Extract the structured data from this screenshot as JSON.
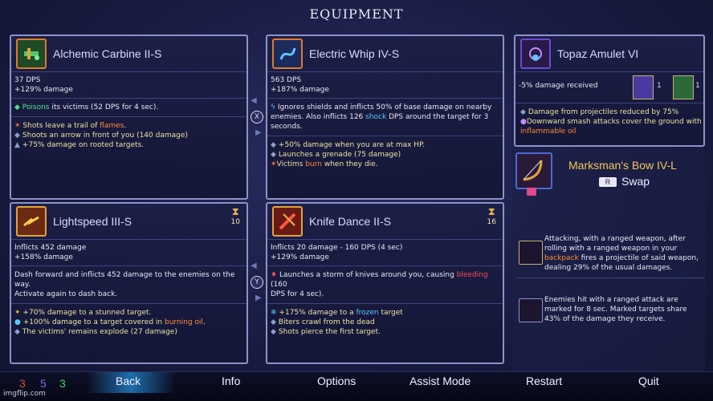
{
  "header": {
    "title": "EQUIPMENT"
  },
  "weapons": [
    {
      "name": "Alchemic Carbine II-S",
      "stats": [
        "37 DPS",
        "+129% damage"
      ],
      "desc": [
        {
          "pre": "",
          "hl": "Poisons",
          "post": " its victims (52 DPS for 4 sec)."
        }
      ],
      "mods": [
        {
          "pre": "Shots leave a trail of ",
          "hl": "flames",
          "post": "."
        },
        {
          "pre": "Shoots an arrow in front of you (140 damage)",
          "hl": "",
          "post": ""
        },
        {
          "pre": "+75% damage on rooted targets.",
          "hl": "",
          "post": ""
        }
      ]
    },
    {
      "name": "Electric Whip IV-S",
      "stats": [
        "563 DPS",
        "+187% damage"
      ],
      "desc_lines": [
        "Ignores shields and inflicts 50% of base damage on nearby",
        "enemies. Also inflicts 126 ",
        "shock",
        " DPS around the target for 3",
        "seconds."
      ],
      "mods": [
        {
          "pre": "+50% damage when you are at max HP.",
          "hl": "",
          "post": ""
        },
        {
          "pre": "Launches a grenade (75 damage)",
          "hl": "",
          "post": ""
        },
        {
          "pre": "Victims ",
          "hl": "burn",
          "post": " when they die."
        }
      ]
    },
    {
      "name": "Lightspeed III-S",
      "timer": "10",
      "stats": [
        "Inflicts 452 damage",
        "+158% damage"
      ],
      "desc_lines": [
        "Dash forward and inflicts 452 damage to the enemies on the way.",
        "Activate again to dash back."
      ],
      "mods": [
        {
          "pre": "+70% damage to a stunned target.",
          "hl": "",
          "post": ""
        },
        {
          "pre": "+100% damage to a target covered in ",
          "hl": "burning oil",
          "post": "."
        },
        {
          "pre": "The victims' remains explode (27 damage)",
          "hl": "",
          "post": ""
        }
      ]
    },
    {
      "name": "Knife Dance II-S",
      "timer": "16",
      "stats": [
        "Inflicts 20 damage - 160 DPS (4 sec)",
        "+129% damage"
      ],
      "desc_lines": [
        "Launches a storm of knives around you, causing ",
        "bleeding",
        " (160",
        "DPS for 4 sec)."
      ],
      "mods": [
        {
          "pre": "+175% damage to a ",
          "hl": "frozen",
          "post": " target"
        },
        {
          "pre": "Biters crawl from the dead",
          "hl": "",
          "post": ""
        },
        {
          "pre": "Shots pierce the first target.",
          "hl": "",
          "post": ""
        }
      ]
    }
  ],
  "amulet": {
    "name": "Topaz Amulet VI",
    "stat": "-5% damage received",
    "scroll_counts": [
      "1",
      "1"
    ],
    "mods": [
      {
        "pre": "Damage from projectiles reduced by 75%",
        "hl": "",
        "post": ""
      },
      {
        "pre": "Downward smash attacks cover the ground with",
        "hl": "",
        "post": ""
      },
      {
        "pre": "",
        "hl": "inflammable oil",
        "post": ""
      }
    ]
  },
  "swap": {
    "name": "Marksman's Bow IV-L",
    "key": "R",
    "label": "Swap",
    "desc1": [
      "Attacking, with a ranged weapon, after",
      "rolling with a ranged weapon in your",
      "backpack",
      " fires a projectile of said weapon,",
      "dealing 29% of the usual damages."
    ],
    "desc2": [
      "Enemies hit with a ranged attack are",
      "marked for 8 sec. Marked targets share",
      "43% of the damage they receive."
    ]
  },
  "buttons": {
    "x": "X",
    "y": "Y"
  },
  "scrolls": {
    "brutality": "3",
    "tactics": "5",
    "survival": "3"
  },
  "nav": [
    "Back",
    "Info",
    "Options",
    "Assist Mode",
    "Restart",
    "Quit"
  ],
  "watermark": "imgflip.com",
  "colors": {
    "brutality": "#e0483c",
    "tactics": "#7d6cf0",
    "survival": "#3fcf5a",
    "border": "#8c93c9"
  }
}
